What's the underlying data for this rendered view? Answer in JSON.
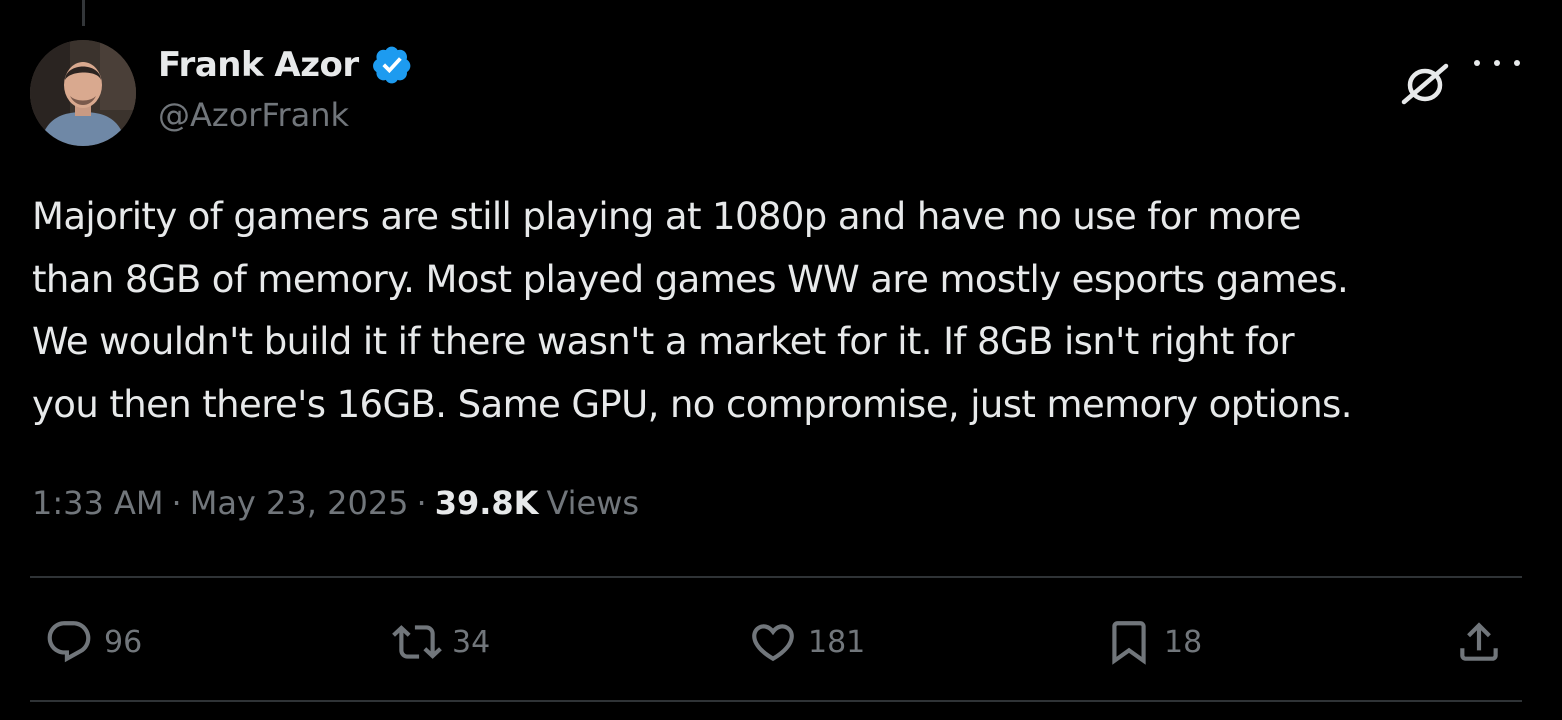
{
  "author": {
    "display_name": "Frank Azor",
    "handle": "@AzorFrank",
    "avatar_icon": "user-avatar-photo",
    "verified_icon": "verified-badge-icon",
    "verified_color": "#1d9bf0"
  },
  "header_actions": {
    "grok_icon": "grok-icon",
    "more_icon": "more-options-icon"
  },
  "tweet": {
    "text": "Majority of gamers are still playing at 1080p and have no use for more\nthan 8GB of memory. Most played games WW are mostly esports games.\nWe wouldn't build it if there wasn't a market for it. If 8GB isn't right for\nyou then there's 16GB. Same GPU, no compromise, just memory options."
  },
  "meta": {
    "time": "1:33 AM",
    "separator": "·",
    "date": "May 23, 2025",
    "views_count": "39.8K",
    "views_label": "Views"
  },
  "actions": {
    "replies": {
      "icon": "reply-icon",
      "count": "96"
    },
    "reposts": {
      "icon": "repost-icon",
      "count": "34"
    },
    "likes": {
      "icon": "like-icon",
      "count": "181"
    },
    "bookmarks": {
      "icon": "bookmark-icon",
      "count": "18"
    },
    "share": {
      "icon": "share-icon"
    }
  },
  "colors": {
    "background": "#000000",
    "text_primary": "#e7e9ea",
    "text_secondary": "#71767b",
    "divider": "#2f3336",
    "verified_blue": "#1d9bf0"
  }
}
